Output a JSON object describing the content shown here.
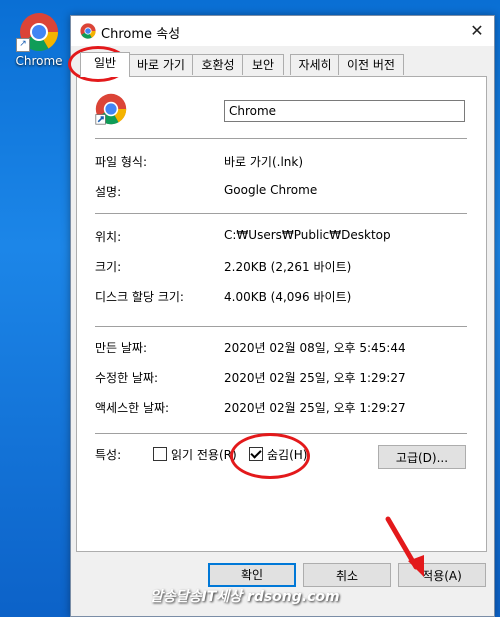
{
  "desktop": {
    "icon_label": "Chrome"
  },
  "window": {
    "title": "Chrome 속성",
    "close": "✕"
  },
  "tabs": [
    {
      "label": "일반"
    },
    {
      "label": "바로 가기"
    },
    {
      "label": "호환성"
    },
    {
      "label": "보안"
    },
    {
      "label": "자세히"
    },
    {
      "label": "이전 버전"
    }
  ],
  "general": {
    "name_value": "Chrome",
    "file_type_label": "파일 형식:",
    "file_type_value": "바로 가기(.lnk)",
    "description_label": "설명:",
    "description_value": "Google Chrome",
    "location_label": "위치:",
    "location_value": "C:₩Users₩Public₩Desktop",
    "size_label": "크기:",
    "size_value": "2.20KB (2,261 바이트)",
    "disk_size_label": "디스크 할당 크기:",
    "disk_size_value": "4.00KB (4,096 바이트)",
    "created_label": "만든 날짜:",
    "created_value": "2020년 02월 08일, 오후 5:45:44",
    "modified_label": "수정한 날짜:",
    "modified_value": "2020년 02월 25일, 오후 1:29:27",
    "accessed_label": "액세스한 날짜:",
    "accessed_value": "2020년 02월 25일, 오후 1:29:27",
    "attributes_label": "특성:",
    "readonly_label": "읽기 전용(R)",
    "readonly_checked": false,
    "hidden_label": "숨김(H)",
    "hidden_checked": true,
    "advanced_button": "고급(D)..."
  },
  "footer": {
    "ok": "확인",
    "cancel": "취소",
    "apply": "적용(A)"
  },
  "watermark": "알송달송IT세상 rdsong.com",
  "colors": {
    "highlight_ring": "#e3191b",
    "desktop_bg": "#1c86e8"
  }
}
